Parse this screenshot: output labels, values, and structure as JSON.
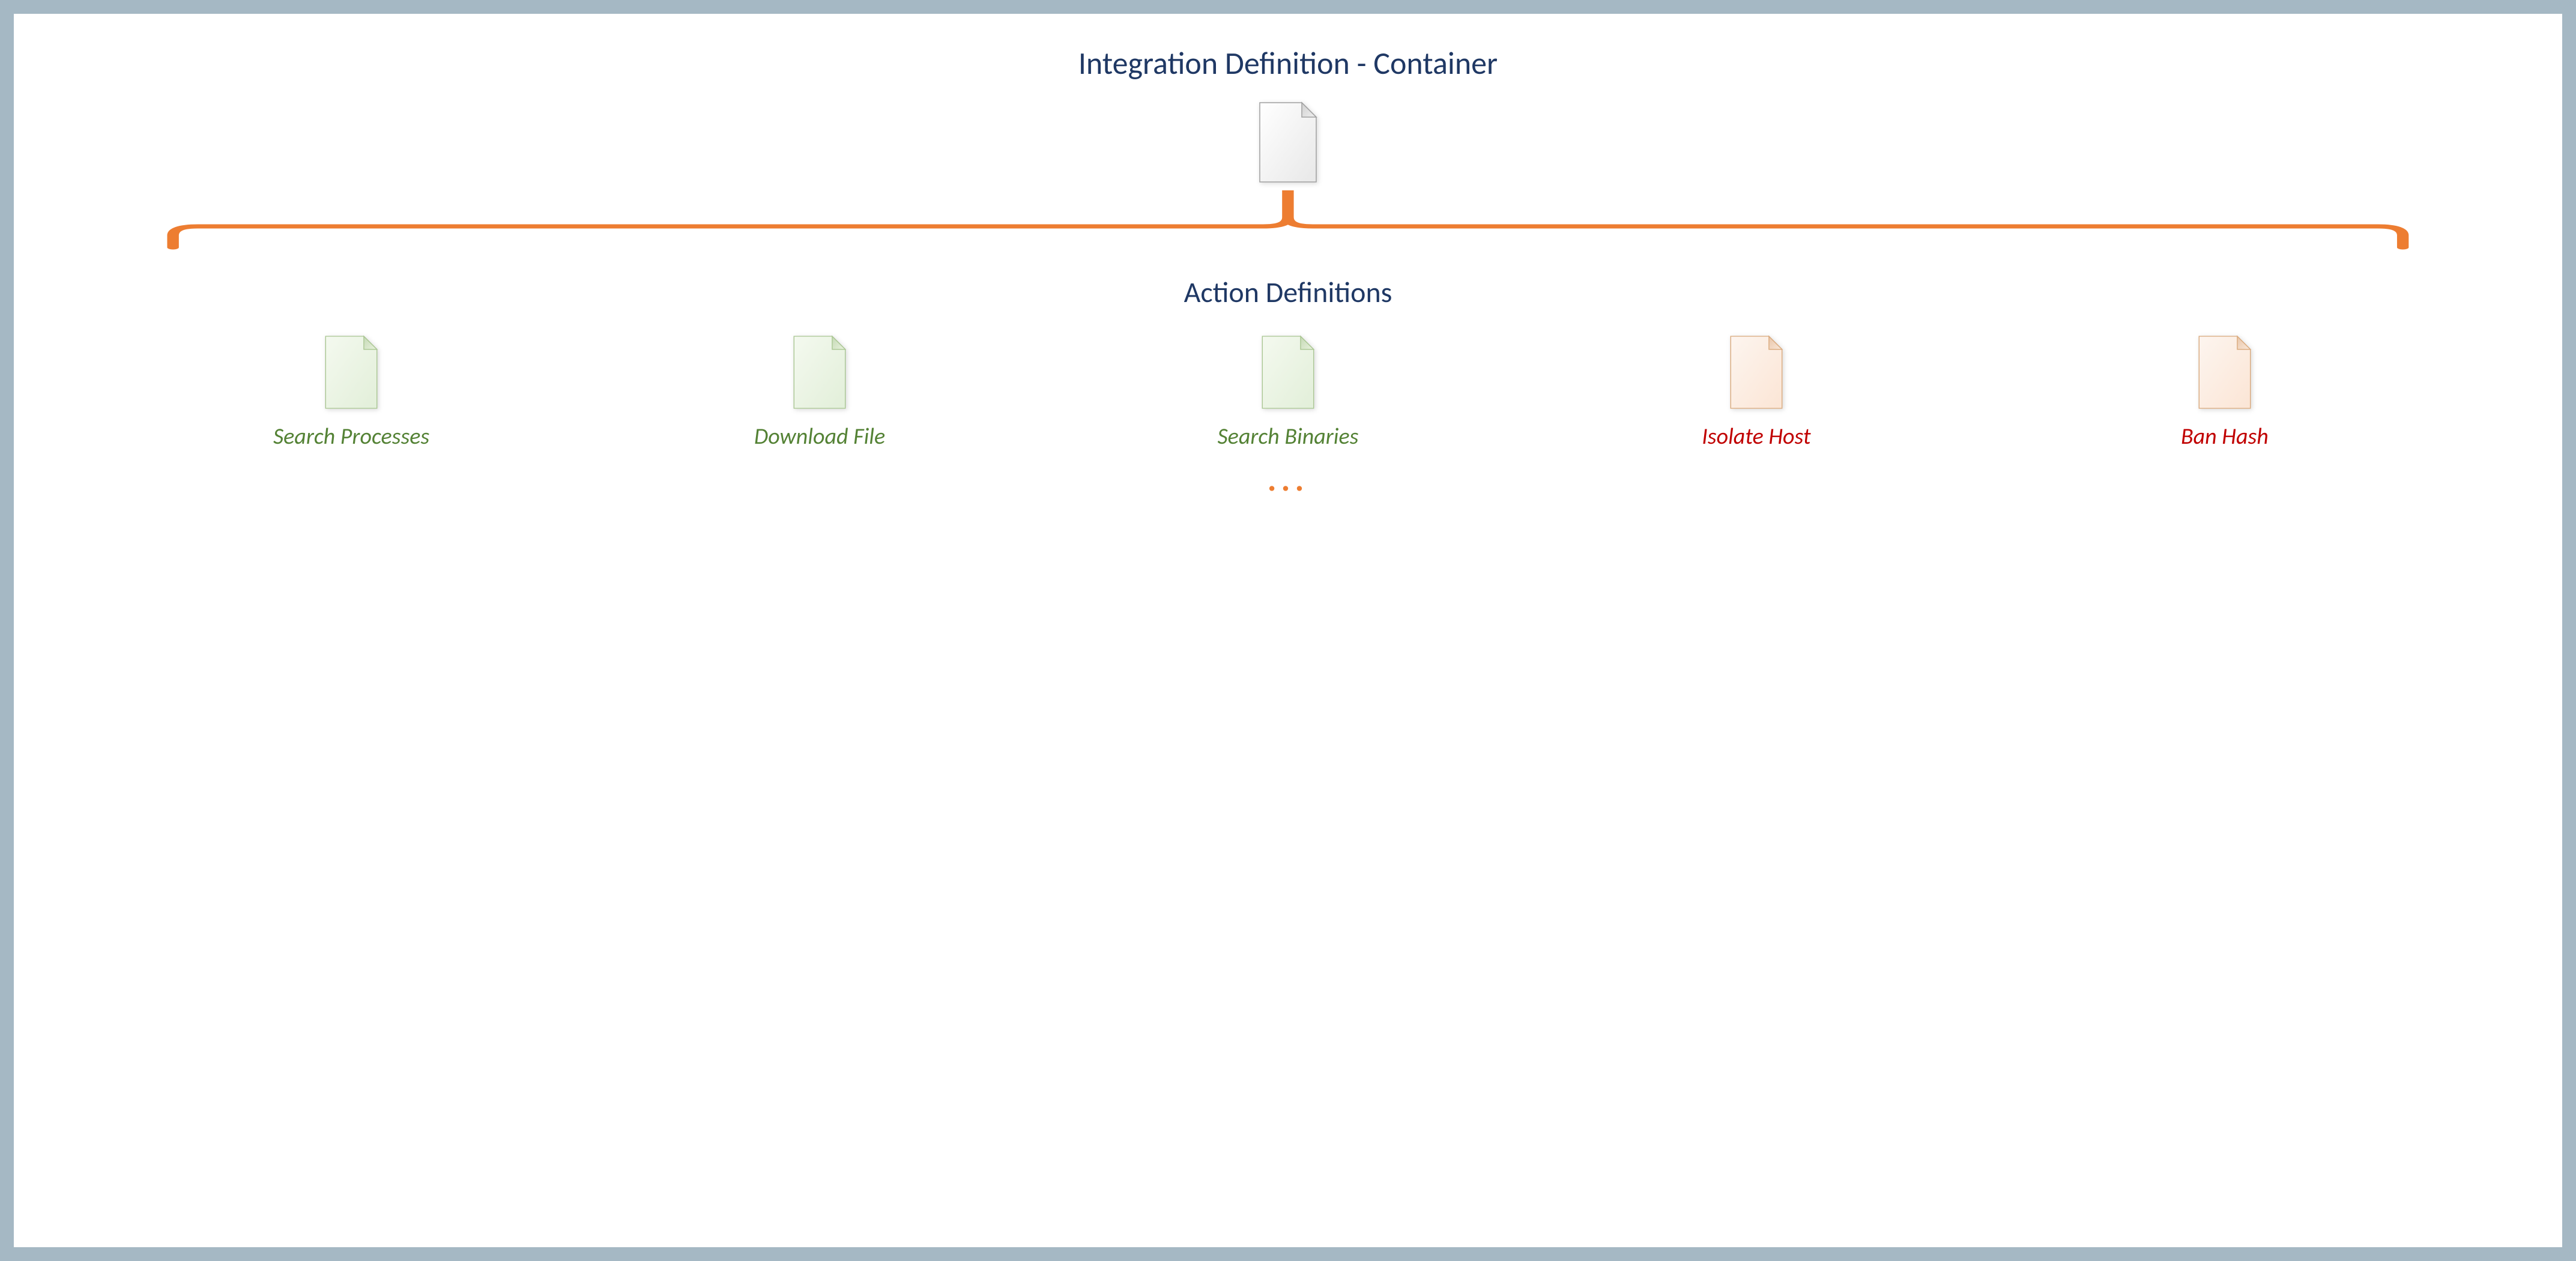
{
  "diagram": {
    "main_title": "Integration Definition - Container",
    "sub_title": "Action Definitions",
    "ellipsis": "...",
    "container_icon": "file-icon-gray",
    "actions": [
      {
        "label": "Search Processes",
        "color": "green",
        "icon": "file-icon-green"
      },
      {
        "label": "Download File",
        "color": "green",
        "icon": "file-icon-green"
      },
      {
        "label": "Search Binaries",
        "color": "green",
        "icon": "file-icon-green"
      },
      {
        "label": "Isolate Host",
        "color": "red",
        "icon": "file-icon-orange"
      },
      {
        "label": "Ban Hash",
        "color": "red",
        "icon": "file-icon-orange"
      }
    ],
    "colors": {
      "title": "#1f3864",
      "brace": "#ed7d31",
      "green_label": "#548235",
      "red_label": "#c00000",
      "border": "#a5b8c4"
    }
  }
}
